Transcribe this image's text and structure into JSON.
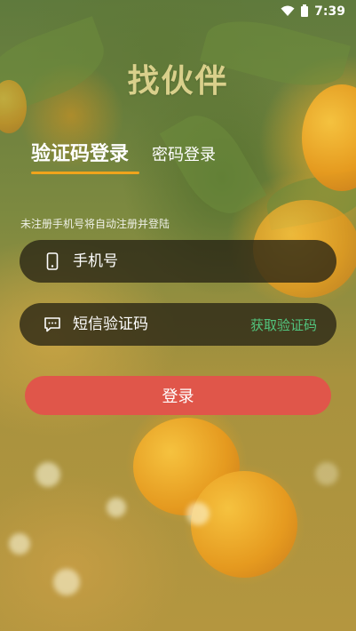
{
  "status_bar": {
    "time": "7:39"
  },
  "app": {
    "title": "找伙伴"
  },
  "tabs": [
    {
      "label": "验证码登录",
      "active": true
    },
    {
      "label": "密码登录",
      "active": false
    }
  ],
  "hint": "未注册手机号将自动注册并登陆",
  "phone_field": {
    "placeholder": "手机号",
    "icon": "phone-icon"
  },
  "code_field": {
    "placeholder": "短信验证码",
    "icon": "message-icon",
    "get_code_label": "获取验证码"
  },
  "login_button": {
    "label": "登录"
  },
  "colors": {
    "accent": "#f0a41c",
    "button": "#e0564a",
    "link": "#52c47e",
    "title": "#d9d08b"
  }
}
